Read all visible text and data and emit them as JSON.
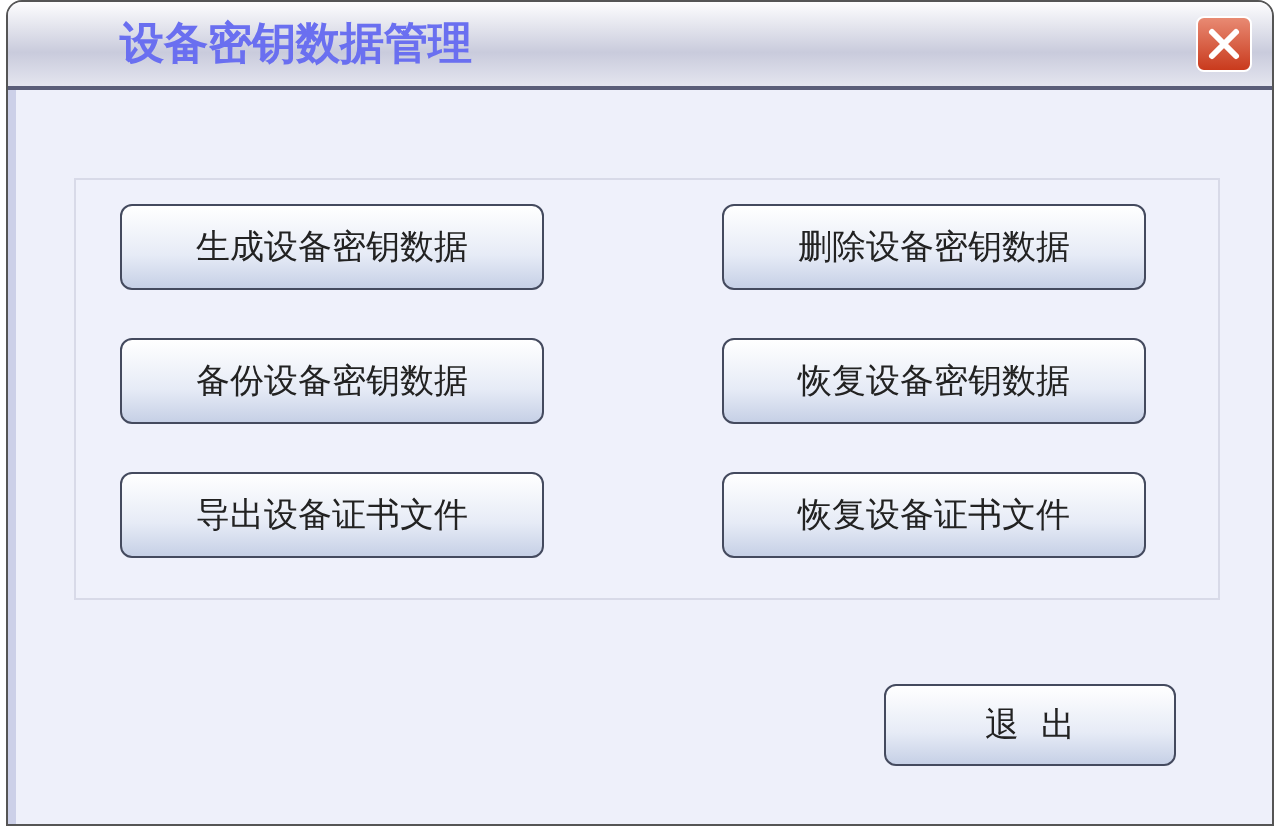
{
  "window": {
    "title": "设备密钥数据管理"
  },
  "buttons": [
    {
      "label": "生成设备密钥数据"
    },
    {
      "label": "删除设备密钥数据"
    },
    {
      "label": "备份设备密钥数据"
    },
    {
      "label": "恢复设备密钥数据"
    },
    {
      "label": "导出设备证书文件"
    },
    {
      "label": "恢复设备证书文件"
    }
  ],
  "exit_button": {
    "label": "退  出"
  }
}
